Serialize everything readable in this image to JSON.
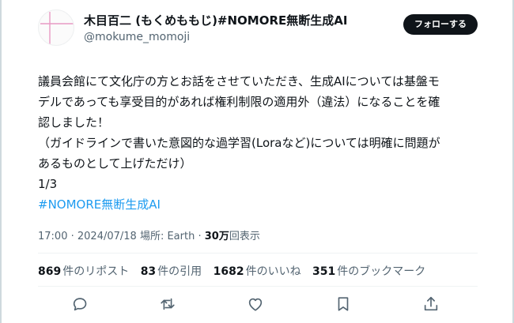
{
  "author": {
    "display_name": "木目百二 (もくめももじ)#NOMORE無断生成AI",
    "handle": "@mokume_momoji",
    "follow_label": "フォローする"
  },
  "tweet": {
    "lines": [
      "議員会館にて文化庁の方とお話をさせていただき、生成AIについては基盤モ",
      "デルであっても享受目的があれば権利制限の適用外（違法）になることを確",
      "認しました！",
      "（ガイドラインで書いた意図的な過学習(Loraなど)については明確に問題が",
      "あるものとして上げただけ）",
      "1/3"
    ],
    "hashtag": "#NOMORE無断生成AI"
  },
  "meta": {
    "time": "17:00",
    "date": "2024/07/18",
    "location": "場所: Earth",
    "views_count": "30万",
    "views_label": "回表示"
  },
  "stats": [
    {
      "count": "869",
      "label": "件のリポスト"
    },
    {
      "count": "83",
      "label": "件の引用"
    },
    {
      "count": "1682",
      "label": "件のいいね"
    },
    {
      "count": "351",
      "label": "件のブックマーク"
    }
  ],
  "actions": [
    {
      "icon": "reply-icon"
    },
    {
      "icon": "repost-icon"
    },
    {
      "icon": "like-icon"
    },
    {
      "icon": "bookmark-icon"
    },
    {
      "icon": "share-icon"
    }
  ],
  "colors": {
    "accent": "#1d9bf0",
    "text": "#0f1419",
    "secondary": "#536471",
    "button_bg": "#0f1419"
  }
}
